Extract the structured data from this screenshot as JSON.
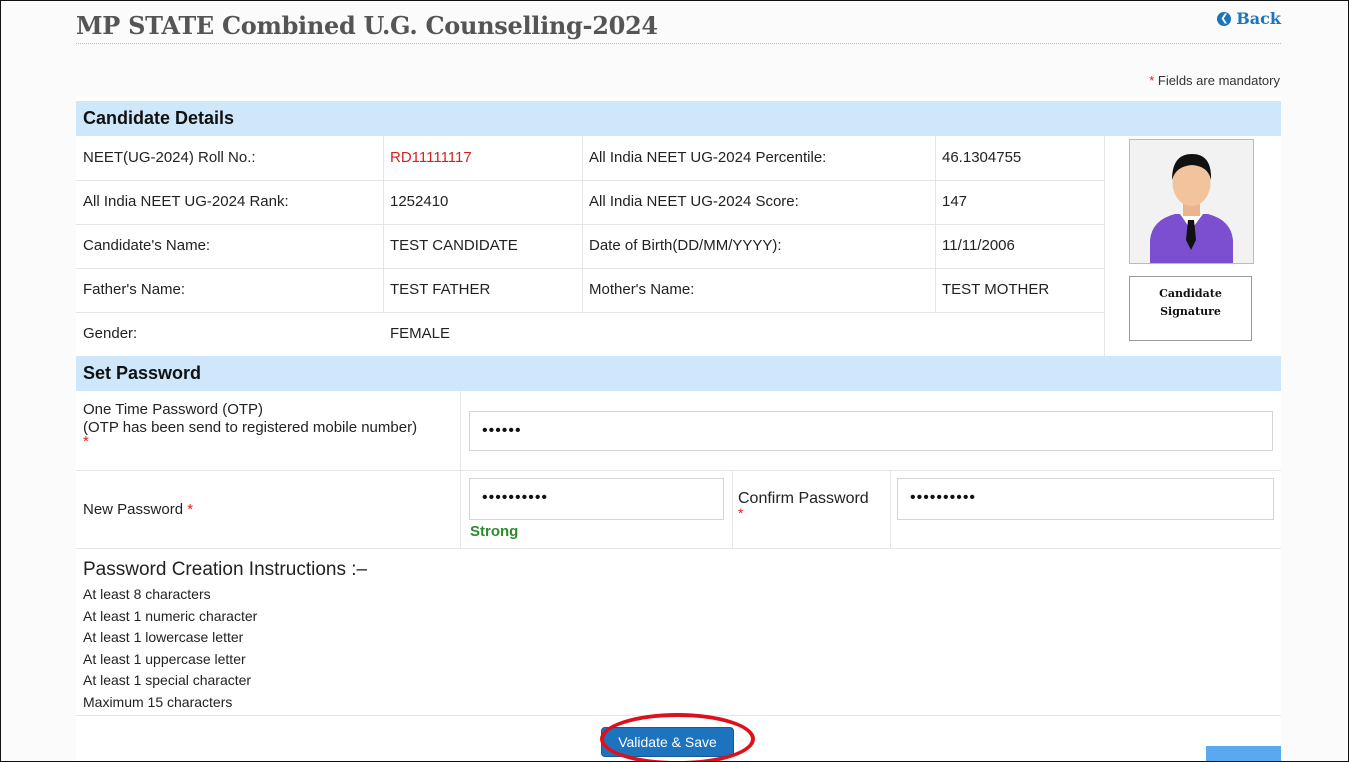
{
  "header": {
    "title": "MP STATE Combined U.G. Counselling-2024",
    "back_label": "Back",
    "mandatory_note": "Fields are mandatory",
    "mandatory_star": "*"
  },
  "candidate_details": {
    "heading": "Candidate Details",
    "rows": [
      {
        "label1": "NEET(UG-2024) Roll No.:",
        "value1": "RD11111117",
        "label2": "All India NEET UG-2024 Percentile:",
        "value2": "46.1304755"
      },
      {
        "label1": "All India NEET UG-2024 Rank:",
        "value1": "1252410",
        "label2": "All India NEET UG-2024 Score:",
        "value2": "147"
      },
      {
        "label1": "Candidate's Name:",
        "value1": "TEST CANDIDATE",
        "label2": "Date of Birth(DD/MM/YYYY):",
        "value2": "11/11/2006"
      },
      {
        "label1": "Father's Name:",
        "value1": "TEST FATHER",
        "label2": "Mother's Name:",
        "value2": "TEST MOTHER"
      },
      {
        "label1": "Gender:",
        "value1": "FEMALE",
        "label2": "",
        "value2": ""
      }
    ],
    "signature_line1": "Candidate",
    "signature_line2": "Signature"
  },
  "set_password": {
    "heading": "Set Password",
    "otp_label_line1": "One Time Password (OTP)",
    "otp_label_line2": "(OTP has been send to registered mobile number)",
    "otp_value": "••••••",
    "required_star": "*",
    "new_password_label": "New Password",
    "new_password_value": "••••••••••",
    "strength": "Strong",
    "confirm_password_label": "Confirm Password",
    "confirm_password_value": "••••••••••",
    "instructions_title": "Password Creation Instructions :–",
    "instructions": [
      "At least 8 characters",
      "At least 1 numeric character",
      "At least 1 lowercase letter",
      "At least 1 uppercase letter",
      "At least 1 special character",
      "Maximum 15 characters"
    ],
    "submit_label": "Validate & Save"
  },
  "colors": {
    "accent": "#1e73be",
    "section_bg": "#cfe7fb",
    "required": "#e02020",
    "strong": "#2e8b2e",
    "highlight": "#e0101a"
  }
}
